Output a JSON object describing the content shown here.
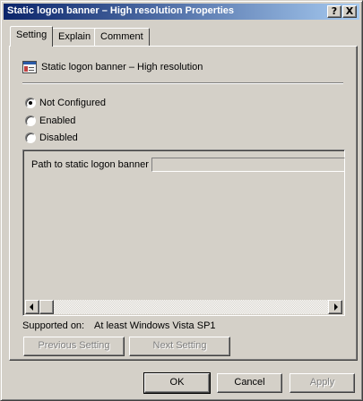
{
  "window": {
    "title": "Static logon banner – High resolution Properties",
    "help_btn": "?",
    "close_btn": "X"
  },
  "tabs": [
    {
      "label": "Setting",
      "active": true
    },
    {
      "label": "Explain",
      "active": false
    },
    {
      "label": "Comment",
      "active": false
    }
  ],
  "policy": {
    "icon": "policy-setting-icon",
    "name": "Static logon banner – High resolution"
  },
  "options": [
    {
      "label": "Not Configured",
      "checked": true
    },
    {
      "label": "Enabled",
      "checked": false
    },
    {
      "label": "Disabled",
      "checked": false
    }
  ],
  "options_box": {
    "path_label": "Path to static logon banner",
    "path_value": ""
  },
  "supported": {
    "label": "Supported on:",
    "value": "At least Windows Vista SP1"
  },
  "nav": {
    "previous": "Previous Setting",
    "next": "Next Setting"
  },
  "footer": {
    "ok": "OK",
    "cancel": "Cancel",
    "apply": "Apply"
  }
}
